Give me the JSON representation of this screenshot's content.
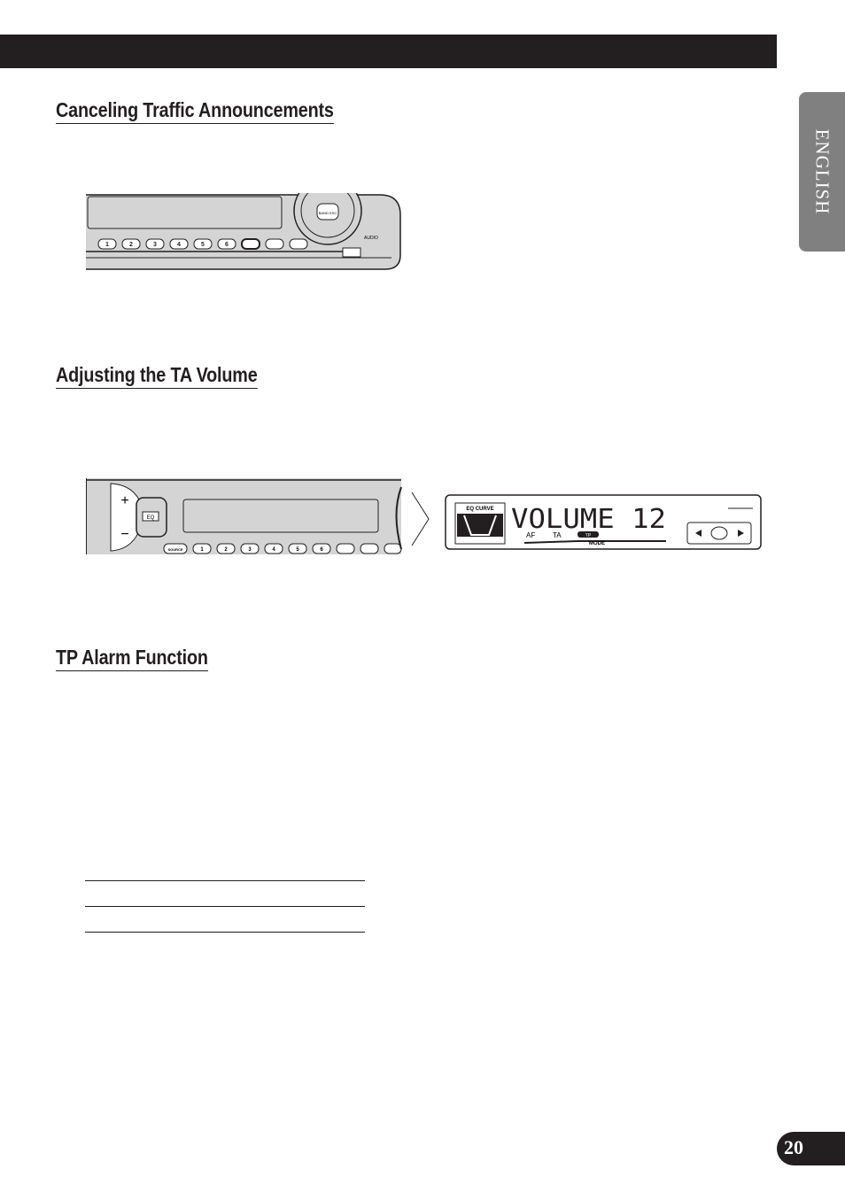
{
  "side_tab": {
    "label": "ENGLISH"
  },
  "sections": [
    {
      "title": "Canceling Traffic Announcements"
    },
    {
      "title": "Adjusting the TA Volume"
    },
    {
      "title": "TP Alarm Function"
    }
  ],
  "figure1": {
    "buttons": [
      "1",
      "2",
      "3",
      "4",
      "5",
      "6"
    ],
    "band_esc": "BAND ESC",
    "audio": "AUDIO"
  },
  "figure2": {
    "source": "SOURCE",
    "eq": "EQ",
    "buttons": [
      "1",
      "2",
      "3",
      "4",
      "5",
      "6"
    ]
  },
  "display": {
    "eq_curve": "EQ CURVE",
    "main_text": "VOLUME  12",
    "af": "AF",
    "ta": "TA",
    "tp": "TP",
    "mode": "MODE"
  },
  "page_number": "20",
  "colors": {
    "bar": "#231f20",
    "tab": "#808080",
    "device_face": "#d4d4d4"
  }
}
